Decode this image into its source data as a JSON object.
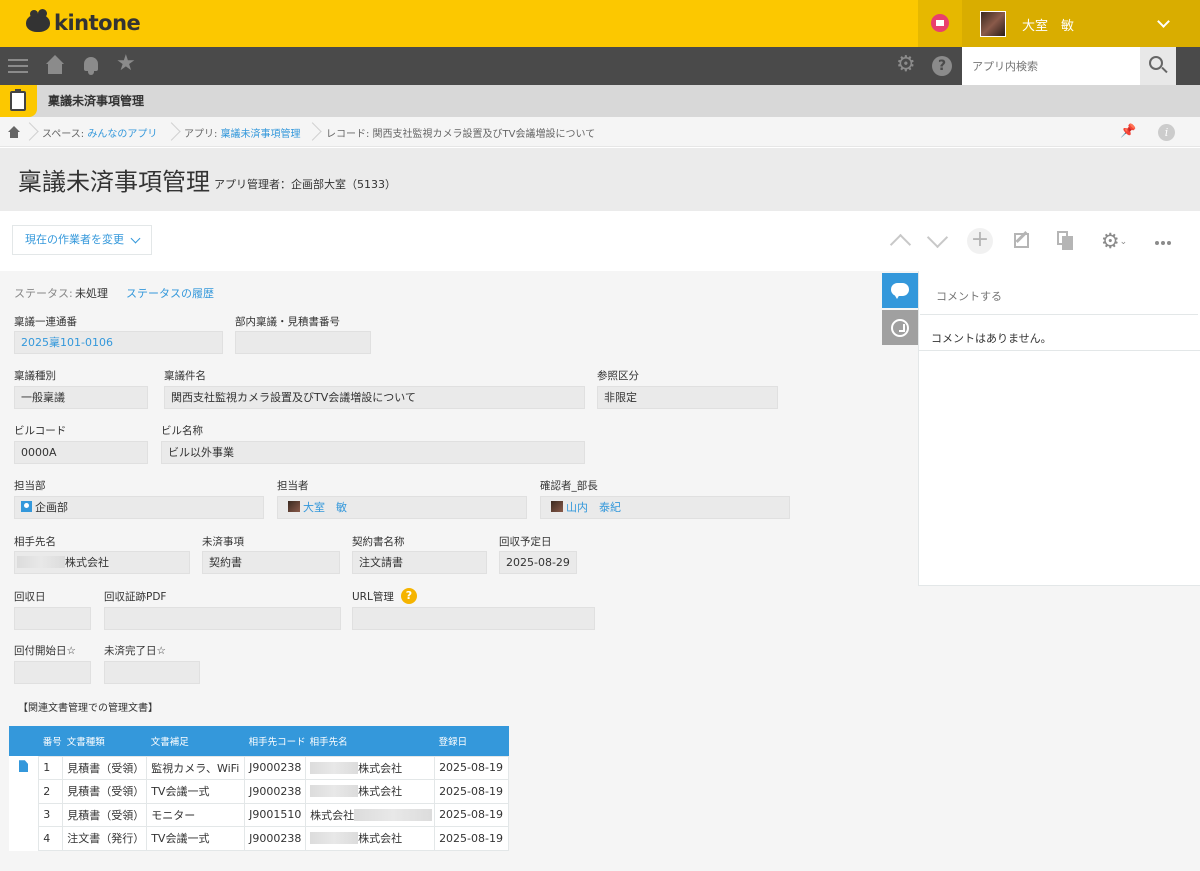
{
  "header": {
    "logo_text": "kintone",
    "user_name": "大室　敏"
  },
  "nav": {
    "search_placeholder": "アプリ内検索"
  },
  "app": {
    "name": "稟議未済事項管理"
  },
  "breadcrumb": {
    "space_prefix": "スペース: ",
    "space_name": "みんなのアプリ",
    "app_prefix": "アプリ: ",
    "app_name": "稟議未済事項管理",
    "record_text": "レコード: 関西支社監視カメラ設置及びTV会議増設について"
  },
  "title": {
    "text": "稟議未済事項管理",
    "admin": "アプリ管理者：企画部大室（5133）"
  },
  "toolbar": {
    "change_worker": "現在の作業者を変更"
  },
  "status": {
    "label": "ステータス:",
    "value": "未処理",
    "history_link": "ステータスの履歴"
  },
  "fields": {
    "serial": {
      "label": "稟議一連通番",
      "value": "2025稟101-0106"
    },
    "dept_no": {
      "label": "部内稟議・見積書番号",
      "value": ""
    },
    "ringi_type": {
      "label": "稟議種別",
      "value": "一般稟議"
    },
    "ringi_subject": {
      "label": "稟議件名",
      "value": "関西支社監視カメラ設置及びTV会議増設について"
    },
    "ref_class": {
      "label": "参照区分",
      "value": "非限定"
    },
    "bldg_code": {
      "label": "ビルコード",
      "value": "0000A"
    },
    "bldg_name": {
      "label": "ビル名称",
      "value": "ビル以外事業"
    },
    "dept": {
      "label": "担当部",
      "value": "企画部"
    },
    "person": {
      "label": "担当者",
      "value": "大室　敏"
    },
    "manager": {
      "label": "確認者_部長",
      "value": "山内　泰紀"
    },
    "partner": {
      "label": "相手先名",
      "value": "株式会社"
    },
    "pending": {
      "label": "未済事項",
      "value": "契約書"
    },
    "contract_name": {
      "label": "契約書名称",
      "value": "注文請書"
    },
    "due_date": {
      "label": "回収予定日",
      "value": "2025-08-29"
    },
    "collected_date": {
      "label": "回収日",
      "value": ""
    },
    "proof_pdf": {
      "label": "回収証跡PDF",
      "value": ""
    },
    "url_mgmt": {
      "label": "URL管理",
      "value": ""
    },
    "circ_start": {
      "label": "回付開始日☆",
      "value": ""
    },
    "pending_done": {
      "label": "未済完了日☆",
      "value": ""
    }
  },
  "related": {
    "section_label": "【関連文書管理での管理文書】",
    "columns": [
      "番号",
      "文書種類",
      "文書補足",
      "相手先コード",
      "相手先名",
      "登録日"
    ],
    "rows": [
      {
        "no": "1",
        "type": "見積書（受領）",
        "note": "監視カメラ、WiFi",
        "code": "J9000238",
        "partner": "株式会社",
        "date": "2025-08-19"
      },
      {
        "no": "2",
        "type": "見積書（受領）",
        "note": "TV会議一式",
        "code": "J9000238",
        "partner": "株式会社",
        "date": "2025-08-19"
      },
      {
        "no": "3",
        "type": "見積書（受領）",
        "note": "モニター",
        "code": "J9001510",
        "partner": "株式会社",
        "date": "2025-08-19"
      },
      {
        "no": "4",
        "type": "注文書（発行）",
        "note": "TV会議一式",
        "code": "J9000238",
        "partner": "株式会社",
        "date": "2025-08-19"
      }
    ]
  },
  "comments": {
    "input_placeholder": "コメントする",
    "empty_text": "コメントはありません。"
  },
  "colors": {
    "brand_yellow": "#fcc800",
    "accent_blue": "#3498db",
    "nav_dark": "#4a4a4a"
  }
}
